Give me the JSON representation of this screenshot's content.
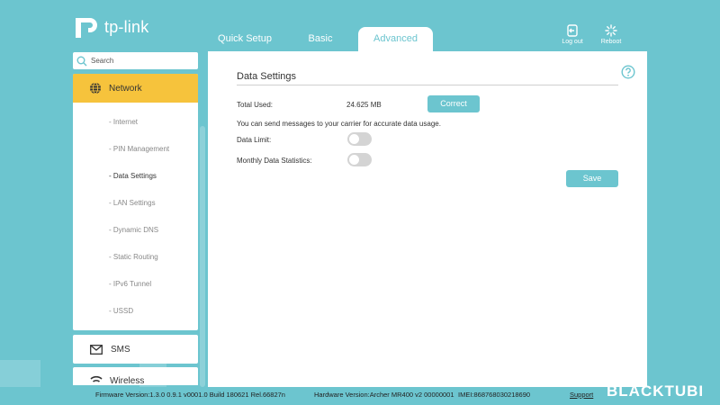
{
  "brand": {
    "logo_text": "tp-link"
  },
  "tabs": [
    {
      "label": "Quick Setup"
    },
    {
      "label": "Basic"
    },
    {
      "label": "Advanced",
      "active": true
    }
  ],
  "header_buttons": {
    "logout": "Log out",
    "reboot": "Reboot"
  },
  "search": {
    "placeholder": "Search"
  },
  "sidebar": {
    "network": {
      "label": "Network",
      "items": [
        {
          "label": "- Internet"
        },
        {
          "label": "- PIN Management"
        },
        {
          "label": "- Data Settings",
          "active": true
        },
        {
          "label": "- LAN Settings"
        },
        {
          "label": "- Dynamic DNS"
        },
        {
          "label": "- Static Routing"
        },
        {
          "label": "- IPv6 Tunnel"
        },
        {
          "label": "- USSD"
        }
      ]
    },
    "sms": {
      "label": "SMS"
    },
    "wireless": {
      "label": "Wireless"
    }
  },
  "main": {
    "title": "Data Settings",
    "total_used_label": "Total Used:",
    "total_used_value": "24.625 MB",
    "correct_button": "Correct",
    "info_text": "You can send messages to your carrier for accurate data usage.",
    "data_limit_label": "Data Limit:",
    "data_limit_on": false,
    "monthly_stats_label": "Monthly Data Statistics:",
    "monthly_stats_on": false,
    "save_button": "Save"
  },
  "footer": {
    "firmware": "Firmware Version:1.3.0 0.9.1 v0001.0 Build 180621 Rel.66827n",
    "hardware": "Hardware Version:Archer MR400 v2 00000001",
    "imei": "IMEI:868768030218690",
    "support": "Support",
    "watermark": "BLACKTUBI"
  },
  "colors": {
    "accent": "#6cc5cf",
    "active_nav": "#f6c33c",
    "toggle_off": "#d4d4d4"
  }
}
